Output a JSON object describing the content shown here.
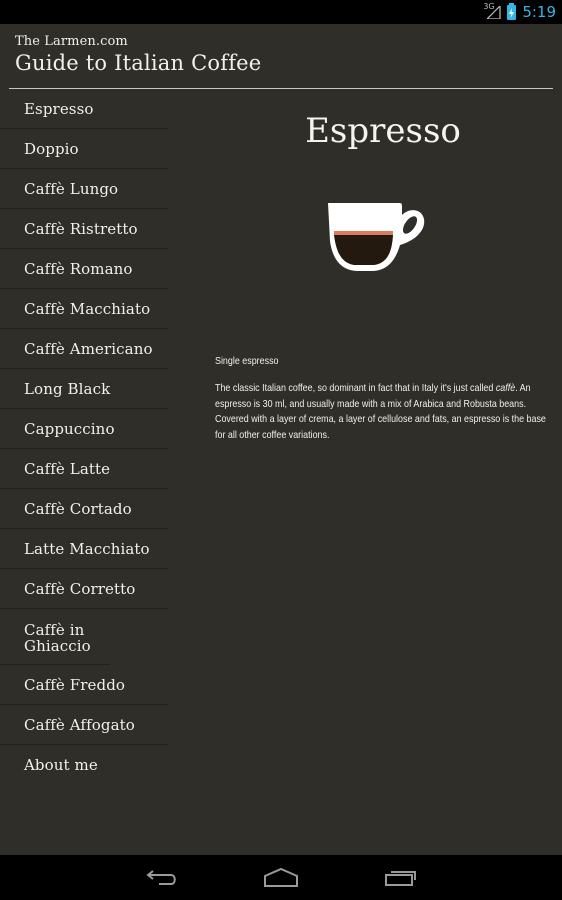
{
  "status_bar": {
    "network": "3G",
    "time": "5:19",
    "accent_color": "#33b5e5"
  },
  "header": {
    "subtitle": "The Larmen.com",
    "title": "Guide to Italian Coffee"
  },
  "sidebar": {
    "items": [
      {
        "label": "Espresso"
      },
      {
        "label": "Doppio"
      },
      {
        "label": "Caffè Lungo"
      },
      {
        "label": "Caffè Ristretto"
      },
      {
        "label": "Caffè Romano"
      },
      {
        "label": "Caffè Macchiato"
      },
      {
        "label": "Caffè Americano"
      },
      {
        "label": "Long Black"
      },
      {
        "label": "Cappuccino"
      },
      {
        "label": "Caffè Latte"
      },
      {
        "label": "Caffè Cortado"
      },
      {
        "label": "Latte Macchiato"
      },
      {
        "label": "Caffè Corretto"
      },
      {
        "label": "Caffè in Ghiaccio"
      },
      {
        "label": "Caffè Freddo"
      },
      {
        "label": "Caffè Affogato"
      },
      {
        "label": "About me"
      }
    ]
  },
  "content": {
    "title": "Espresso",
    "image_icon": "espresso-cup-icon",
    "variant": "Single espresso",
    "description_before": "The classic Italian coffee, so dominant in fact that in Italy it's just called ",
    "description_emphasis": "caffè",
    "description_after": ". An espresso is 30 ml, and usually made with a mix of Arabica and Robusta beans. Covered with a layer of crema, a layer of cellulose and fats, an espresso is the base for all other coffee variations."
  },
  "navigation_bar": {
    "buttons": [
      {
        "icon": "back-icon"
      },
      {
        "icon": "home-icon"
      },
      {
        "icon": "recent-apps-icon"
      }
    ]
  }
}
